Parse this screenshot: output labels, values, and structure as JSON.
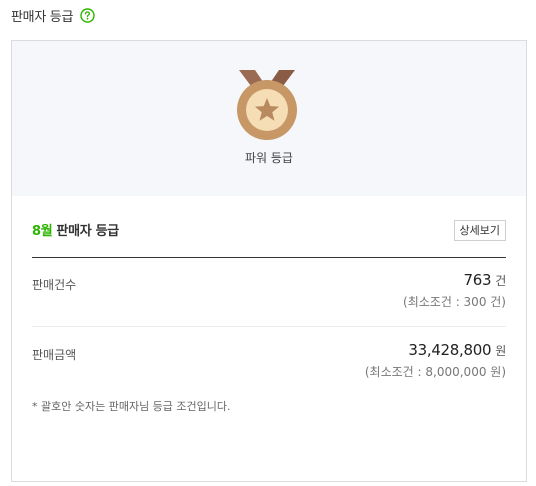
{
  "header": {
    "title": "판매자 등급",
    "help_icon": "question-circle-icon",
    "help_color": "#2db400"
  },
  "grade": {
    "name": "파워 등급",
    "medal_icon": "bronze-medal-star-icon"
  },
  "summary": {
    "month": "8월",
    "title": "판매자 등급",
    "detail_button": "상세보기"
  },
  "stats": [
    {
      "label": "판매건수",
      "value": "763",
      "unit": "건",
      "condition": "(최소조건 : 300 건)"
    },
    {
      "label": "판매금액",
      "value": "33,428,800",
      "unit": "원",
      "condition": "(최소조건 : 8,000,000 원)"
    }
  ],
  "note": "* 괄호안 숫자는 판매자님 등급 조건입니다.",
  "colors": {
    "accent_green": "#2db400",
    "medal_outer": "#c79766",
    "medal_inner": "#f5ddb6",
    "ribbon": "#9a6b52",
    "panel_bg": "#f6f7fb"
  }
}
